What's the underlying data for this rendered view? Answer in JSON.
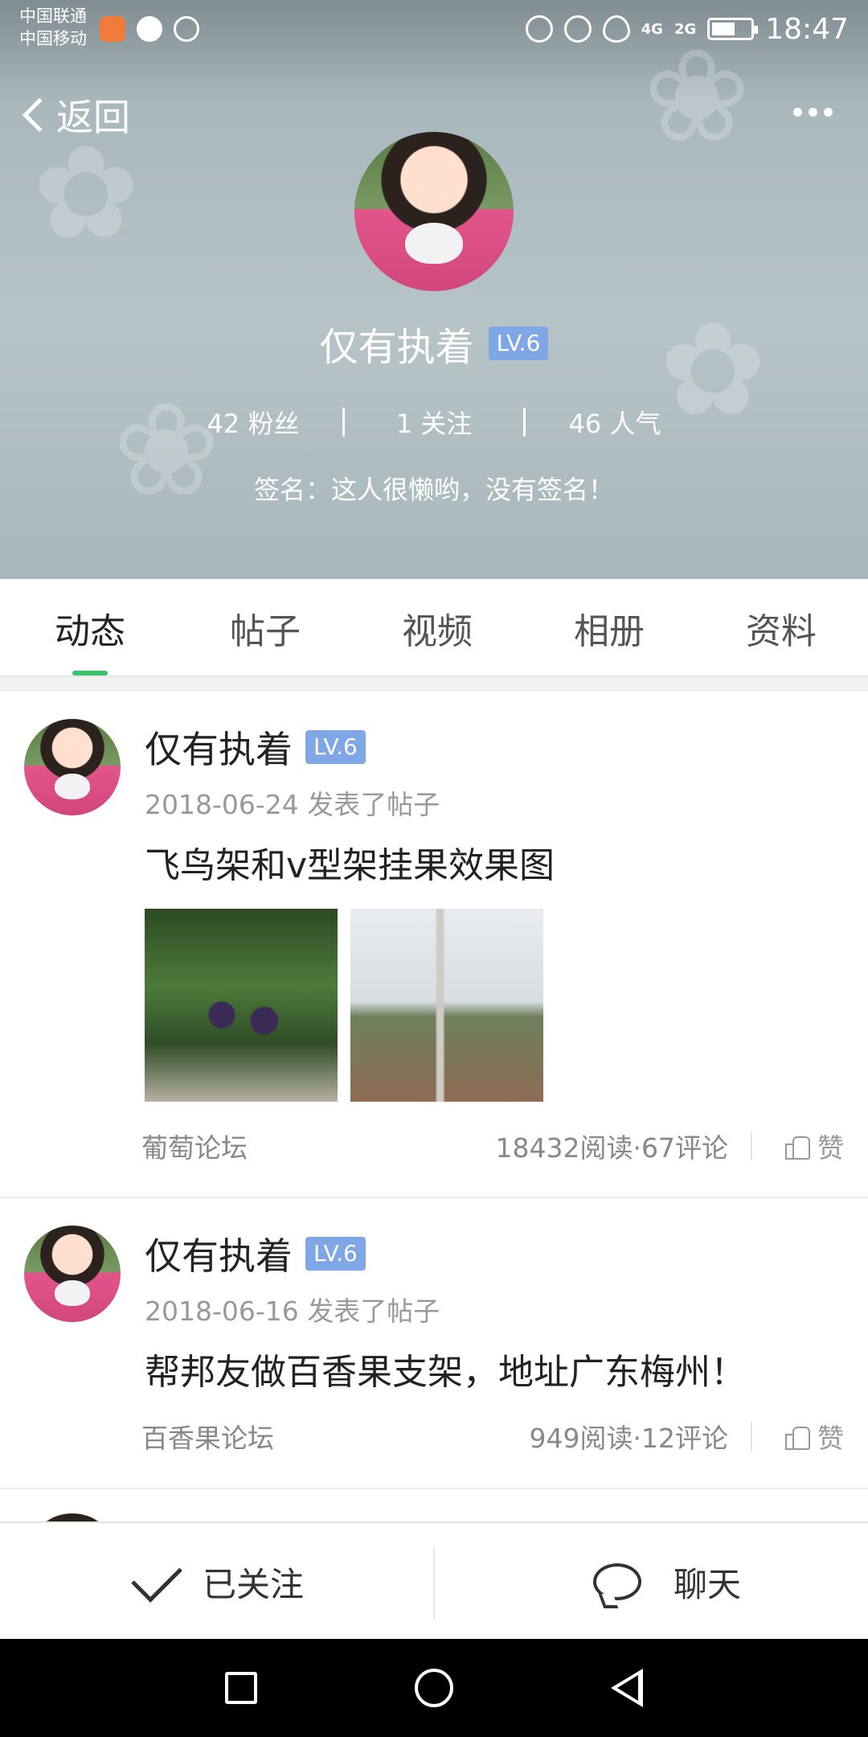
{
  "status_bar": {
    "carrier1": "中国联通",
    "carrier2": "中国移动",
    "signal1": "4G",
    "signal2": "2G",
    "time": "18:47",
    "battery_level": 0.55
  },
  "header": {
    "back_label": "返回",
    "name": "仅有执着",
    "level": "LV.6",
    "stats": {
      "fans": "42 粉丝",
      "follow": "1 关注",
      "popularity": "46 人气"
    },
    "signature": "签名：这人很懒哟，没有签名！"
  },
  "tabs": [
    "动态",
    "帖子",
    "视频",
    "相册",
    "资料"
  ],
  "active_tab": 0,
  "posts": [
    {
      "name": "仅有执着",
      "level": "LV.6",
      "date_action": "2018-06-24  发表了帖子",
      "title": "飞鸟架和v型架挂果效果图",
      "forum": "葡萄论坛",
      "counts": "18432阅读·67评论",
      "like": "赞"
    },
    {
      "name": "仅有执着",
      "level": "LV.6",
      "date_action": "2018-06-16  发表了帖子",
      "title": "帮邦友做百香果支架，地址广东梅州！",
      "forum": "百香果论坛",
      "counts": "949阅读·12评论",
      "like": "赞"
    }
  ],
  "bottom_bar": {
    "follow_label": "已关注",
    "chat_label": "聊天"
  },
  "colors": {
    "accent": "#3cc16b",
    "level_badge": "#7fa7e6"
  }
}
